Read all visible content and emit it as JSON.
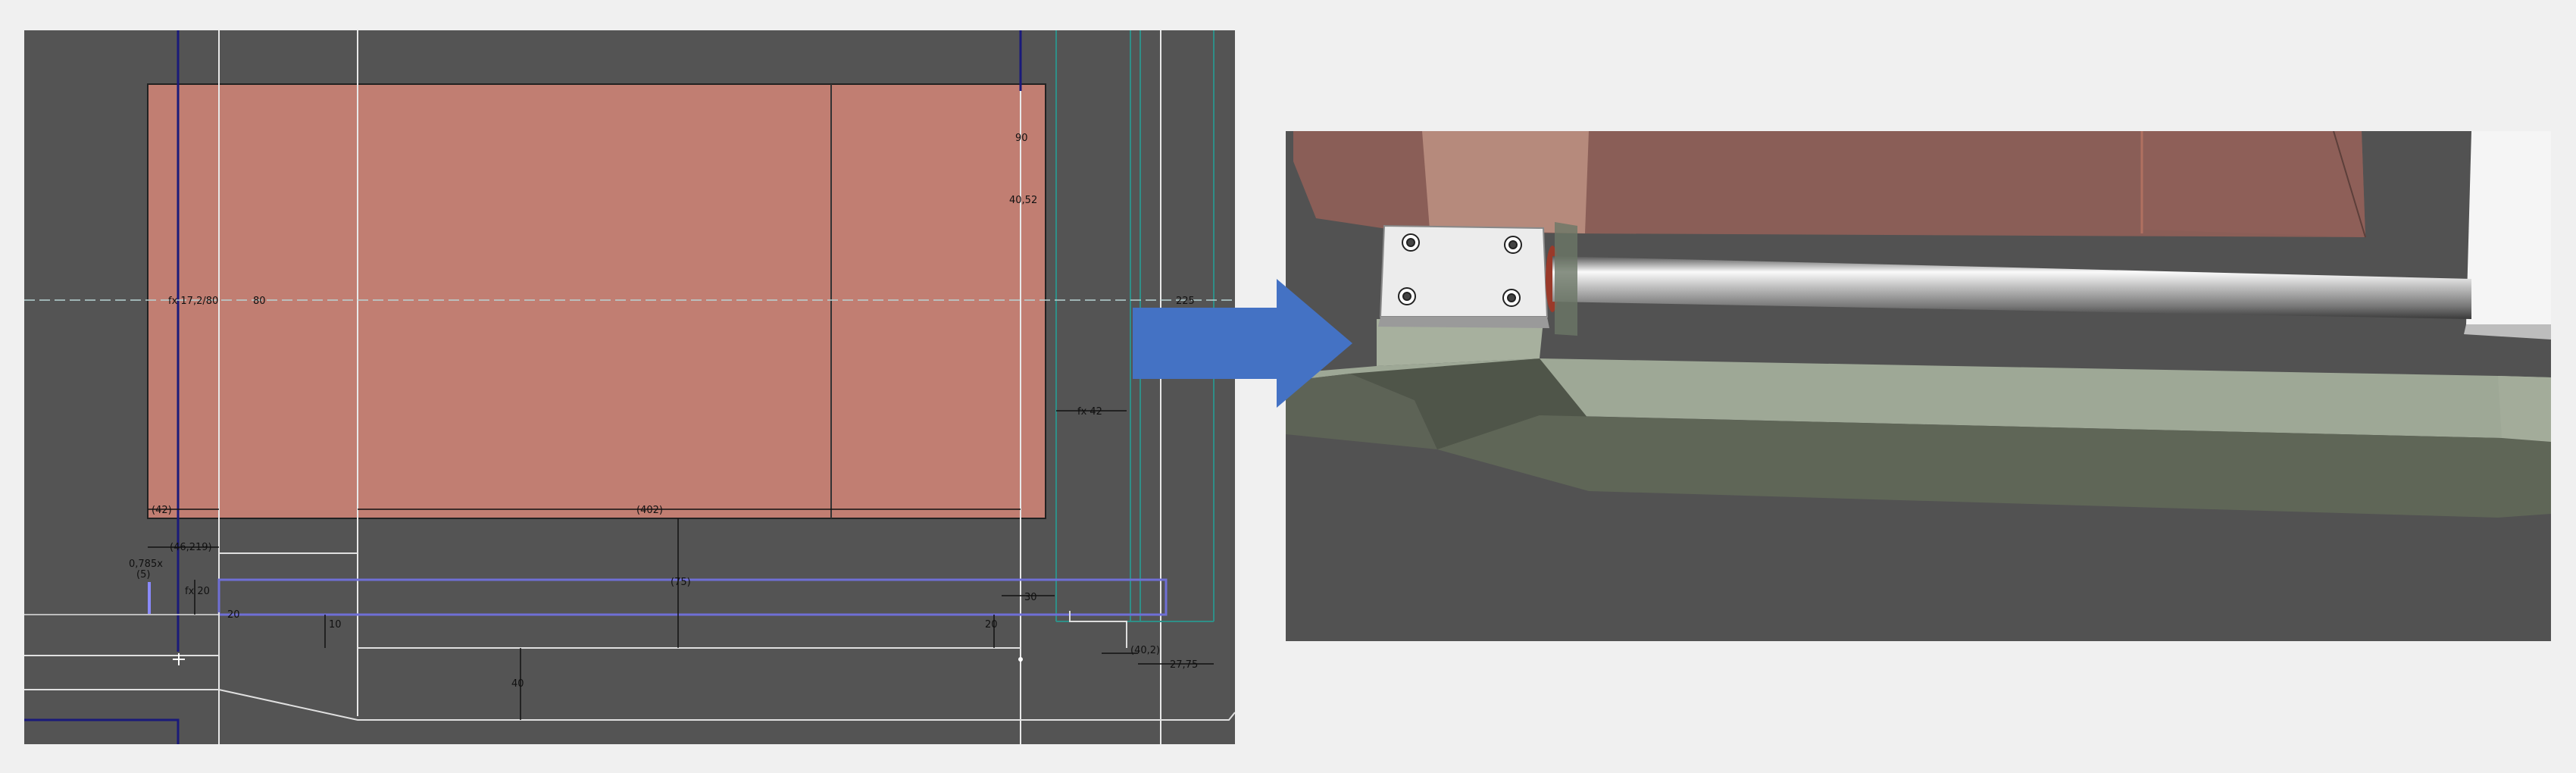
{
  "sketch": {
    "dimensions": {
      "d_17": "fx 17,2/80",
      "d_80": "80",
      "d_fx42": "fx 42",
      "d_42": "(42)",
      "d_402": "(402)",
      "d_46219": "(46,219)",
      "d_0785": "0,785x",
      "d_5": "(5)",
      "d_fx20": "fx 20",
      "d_75": "(75)",
      "d_10": "10",
      "d_20a": "20",
      "d_20b": "20",
      "d_40": "40",
      "d_4052": "40,52",
      "d_90": "90",
      "d_2775": "27,75",
      "d_402r": "(40,2)",
      "d_h30": "30",
      "d_r225": "225"
    }
  },
  "colors": {
    "sketch_bg": "#545454",
    "block_fill": "#c17e72",
    "constraint_blue": "#6f6fd6",
    "construction_teal": "#2f8f88",
    "arrow_blue": "#4472c4",
    "guide_fill": "#9ea896"
  },
  "icons": [
    "right-arrow-icon",
    "origin-point-icon"
  ]
}
